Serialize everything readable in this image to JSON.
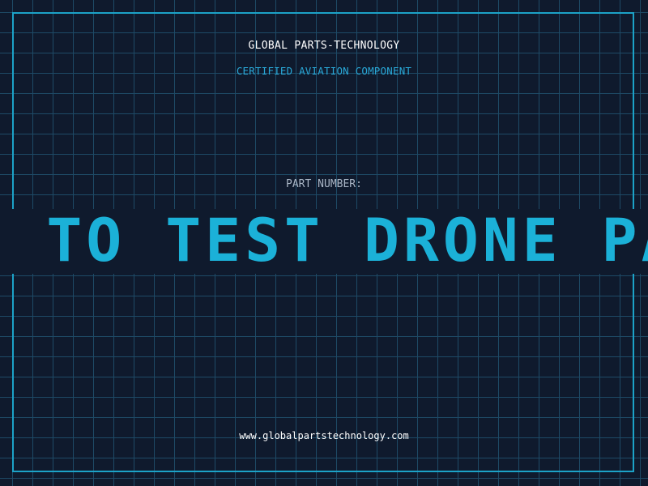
{
  "label": {
    "company": "GLOBAL PARTS-TECHNOLOGY",
    "tagline": "CERTIFIED AVIATION COMPONENT",
    "part_number_label": "PART NUMBER:",
    "part_number_value": "PLAN TO TEST DRONE PARTS",
    "website": "www.globalpartstechnology.com"
  },
  "colors": {
    "background": "#0f1a2d",
    "grid": "#1e4a66",
    "accent": "#1ca2c7",
    "part_number": "#1bb1d8",
    "text_primary": "#ffffff",
    "text_muted": "#aab6c6"
  }
}
